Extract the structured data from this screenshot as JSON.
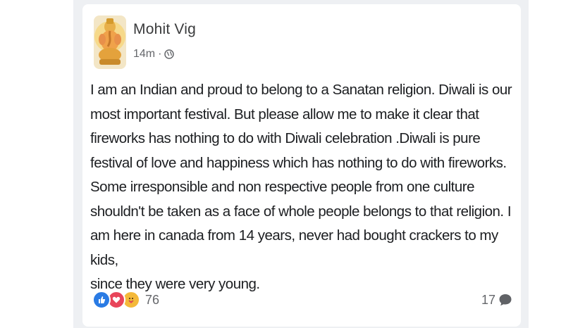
{
  "post": {
    "author": "Mohit Vig",
    "time": "14m",
    "separator": "·",
    "privacy_icon": "globe-icon",
    "avatar_icon": "deity-avatar",
    "text": "I am an Indian and proud to belong to a Sanatan religion. Diwali is our\nmost important festival. But please allow me to make it clear that\nfireworks has nothing to do with Diwali celebration .Diwali is pure\nfestival of love and happiness which has nothing to do with fireworks.\nSome irresponsible and non respective people from one culture\nshouldn't be taken as a face of whole people belongs to that religion.  I\nam here in canada from 14 years, never had bought crackers to my kids,\nsince they were very young."
  },
  "footer": {
    "reaction_icons": [
      "like-icon",
      "love-icon",
      "care-icon"
    ],
    "reaction_count": "76",
    "comment_count": "17",
    "comment_icon": "comment-bubble-icon"
  },
  "colors": {
    "like": "#2a7be4",
    "love": "#e8455a",
    "care": "#f4b93a",
    "frame": "#eef0f3",
    "text": "#1c1e21",
    "secondary_text": "#65676b"
  }
}
